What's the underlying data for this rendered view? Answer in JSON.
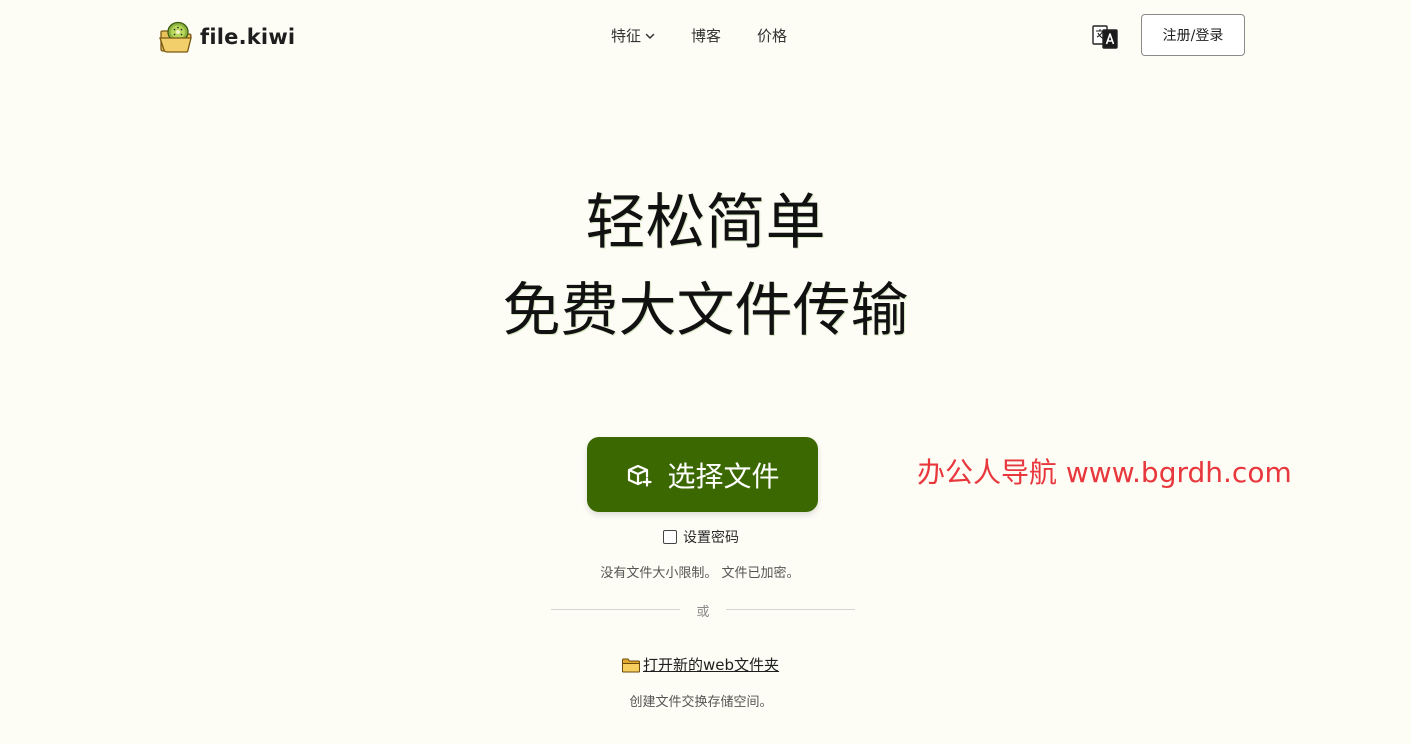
{
  "header": {
    "brand_name": "file.kiwi",
    "nav": {
      "features": "特征",
      "blog": "博客",
      "pricing": "价格"
    },
    "signup_label": "注册/登录"
  },
  "hero": {
    "line1": "轻松简单",
    "line2": "免费大文件传输"
  },
  "upload": {
    "choose_label": "选择文件",
    "password_label": "设置密码",
    "limit_note": "没有文件大小限制。 文件已加密。",
    "divider_text": "或",
    "folder_link": "打开新的web文件夹",
    "folder_note": "创建文件交换存储空间。"
  },
  "watermark": "办公人导航  www.bgrdh.com",
  "colors": {
    "background": "#fdfcf5",
    "primary_button": "#3b6800",
    "watermark": "#e8383d"
  },
  "icons": {
    "logo": "kiwi-folder-logo",
    "translate": "translate-icon",
    "upload": "box-upload-icon",
    "folder": "folder-icon",
    "dropdown": "chevron-down-icon"
  }
}
